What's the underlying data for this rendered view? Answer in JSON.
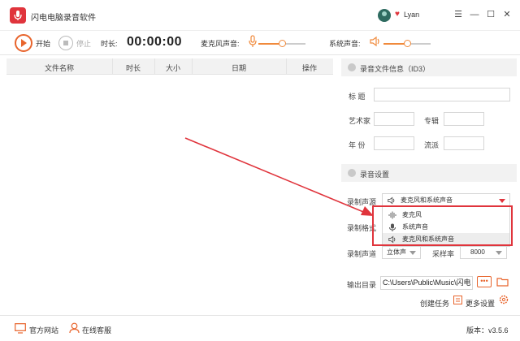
{
  "app": {
    "title": "闪电电脑录音软件",
    "user_name": "Lyan",
    "window_controls": [
      "☰",
      "—",
      "☐",
      "✕"
    ]
  },
  "toolbar": {
    "start_label": "开始",
    "stop_label": "停止",
    "duration_label": "时长:",
    "duration_value": "00:00:00",
    "mic_label": "麦克风声音:",
    "system_label": "系统声音:",
    "mic_volume_fraction": 0.5,
    "system_volume_fraction": 0.5
  },
  "file_table": {
    "columns": [
      "文件名称",
      "时长",
      "大小",
      "日期",
      "操作"
    ]
  },
  "id3": {
    "section_title": "录音文件信息（ID3）",
    "title_label": "标  题",
    "artist_label": "艺术家",
    "album_label": "专辑",
    "year_label": "年  份",
    "genre_label": "流派"
  },
  "settings": {
    "section_title": "录音设置",
    "source_label": "录制声源",
    "source_value": "麦克风和系统声音",
    "source_options": [
      "麦克风",
      "系统声音",
      "麦克风和系统声音"
    ],
    "format_label": "录制格式",
    "channel_label": "录制声道",
    "channel_value": "立体声",
    "sample_rate_label": "采样率",
    "sample_rate_value": "8000",
    "output_label": "输出目录",
    "output_path": "C:\\Users\\Public\\Music\\闪电",
    "browse_label": "•••",
    "create_task_label": "创建任务",
    "more_settings_label": "更多设置"
  },
  "footer": {
    "website_label": "官方网站",
    "support_label": "在线客服",
    "version": "版本：v3.5.6"
  },
  "colors": {
    "accent": "#e8642c",
    "brand_red": "#e0343c",
    "header_bg": "#f2f2f2"
  }
}
